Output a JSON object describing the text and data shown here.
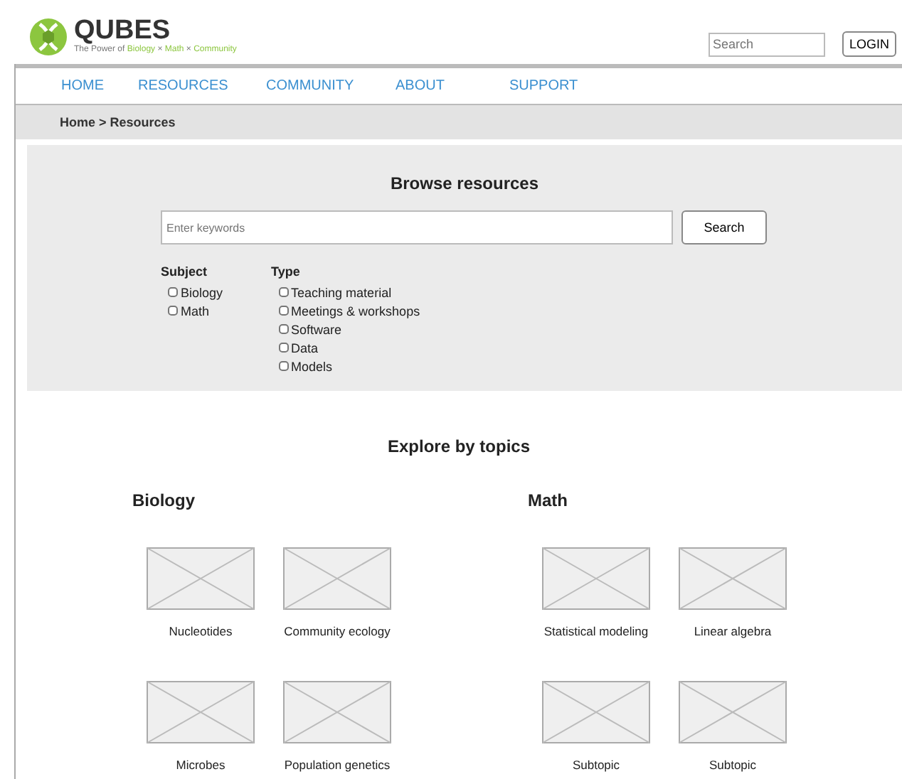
{
  "logo": {
    "name": "QUBES",
    "tagline": [
      {
        "text": "The Power of ",
        "highlight": false
      },
      {
        "text": "Biology",
        "highlight": true
      },
      {
        "text": " × ",
        "highlight": false
      },
      {
        "text": "Math",
        "highlight": true
      },
      {
        "text": " × ",
        "highlight": false
      },
      {
        "text": "Community",
        "highlight": true
      }
    ]
  },
  "search": {
    "placeholder": "Search"
  },
  "login": "LOGIN",
  "nav": [
    "HOME",
    "RESOURCES",
    "COMMUNITY",
    "ABOUT",
    "SUPPORT"
  ],
  "breadcrumb": "Home > Resources",
  "browse": {
    "title": "Browse resources",
    "placeholder": "Enter keywords",
    "button": "Search",
    "filters": [
      {
        "heading": "Subject",
        "options": [
          {
            "label": "Biology",
            "checked": false
          },
          {
            "label": "Math",
            "checked": false
          }
        ]
      },
      {
        "heading": "Type",
        "options": [
          {
            "label": "Teaching material",
            "checked": false
          },
          {
            "label": "Meetings & workshops",
            "checked": false
          },
          {
            "label": "Software",
            "checked": false
          },
          {
            "label": "Data",
            "checked": false
          },
          {
            "label": "Models",
            "checked": false
          }
        ]
      }
    ]
  },
  "explore": {
    "title": "Explore by topics",
    "groups": [
      {
        "heading": "Biology",
        "topics": [
          "Nucleotides",
          "Community ecology",
          "Microbes",
          "Population genetics"
        ]
      },
      {
        "heading": "Math",
        "topics": [
          "Statistical modeling",
          "Linear algebra",
          "Subtopic",
          "Subtopic"
        ]
      }
    ]
  }
}
